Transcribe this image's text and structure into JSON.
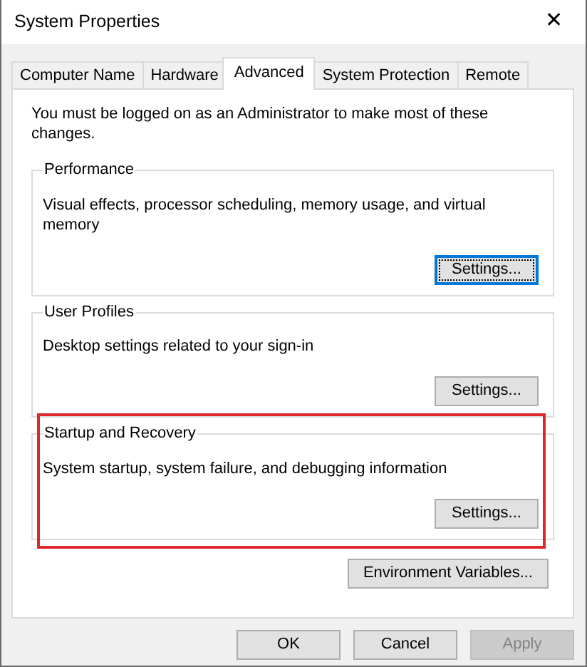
{
  "window": {
    "title": "System Properties",
    "close": "✕"
  },
  "tabs": [
    {
      "label": "Computer Name",
      "selected": false
    },
    {
      "label": "Hardware",
      "selected": false
    },
    {
      "label": "Advanced",
      "selected": true
    },
    {
      "label": "System Protection",
      "selected": false
    },
    {
      "label": "Remote",
      "selected": false
    }
  ],
  "notice": "You must be logged on as an Administrator to make most of these changes.",
  "groups": [
    {
      "title": "Performance",
      "description": "Visual effects, processor scheduling, memory usage, and virtual memory",
      "button": {
        "label": "Settings...",
        "focused": true
      },
      "highlighted": false
    },
    {
      "title": "User Profiles",
      "description": "Desktop settings related to your sign-in",
      "button": {
        "label": "Settings...",
        "focused": false
      },
      "highlighted": false
    },
    {
      "title": "Startup and Recovery",
      "description": "System startup, system failure, and debugging information",
      "button": {
        "label": "Settings...",
        "focused": false
      },
      "highlighted": true
    }
  ],
  "environment_button": {
    "label": "Environment Variables...",
    "focused": false
  },
  "buttons": [
    {
      "label": "OK",
      "disabled": false
    },
    {
      "label": "Cancel",
      "disabled": false
    },
    {
      "label": "Apply",
      "disabled": true
    }
  ]
}
